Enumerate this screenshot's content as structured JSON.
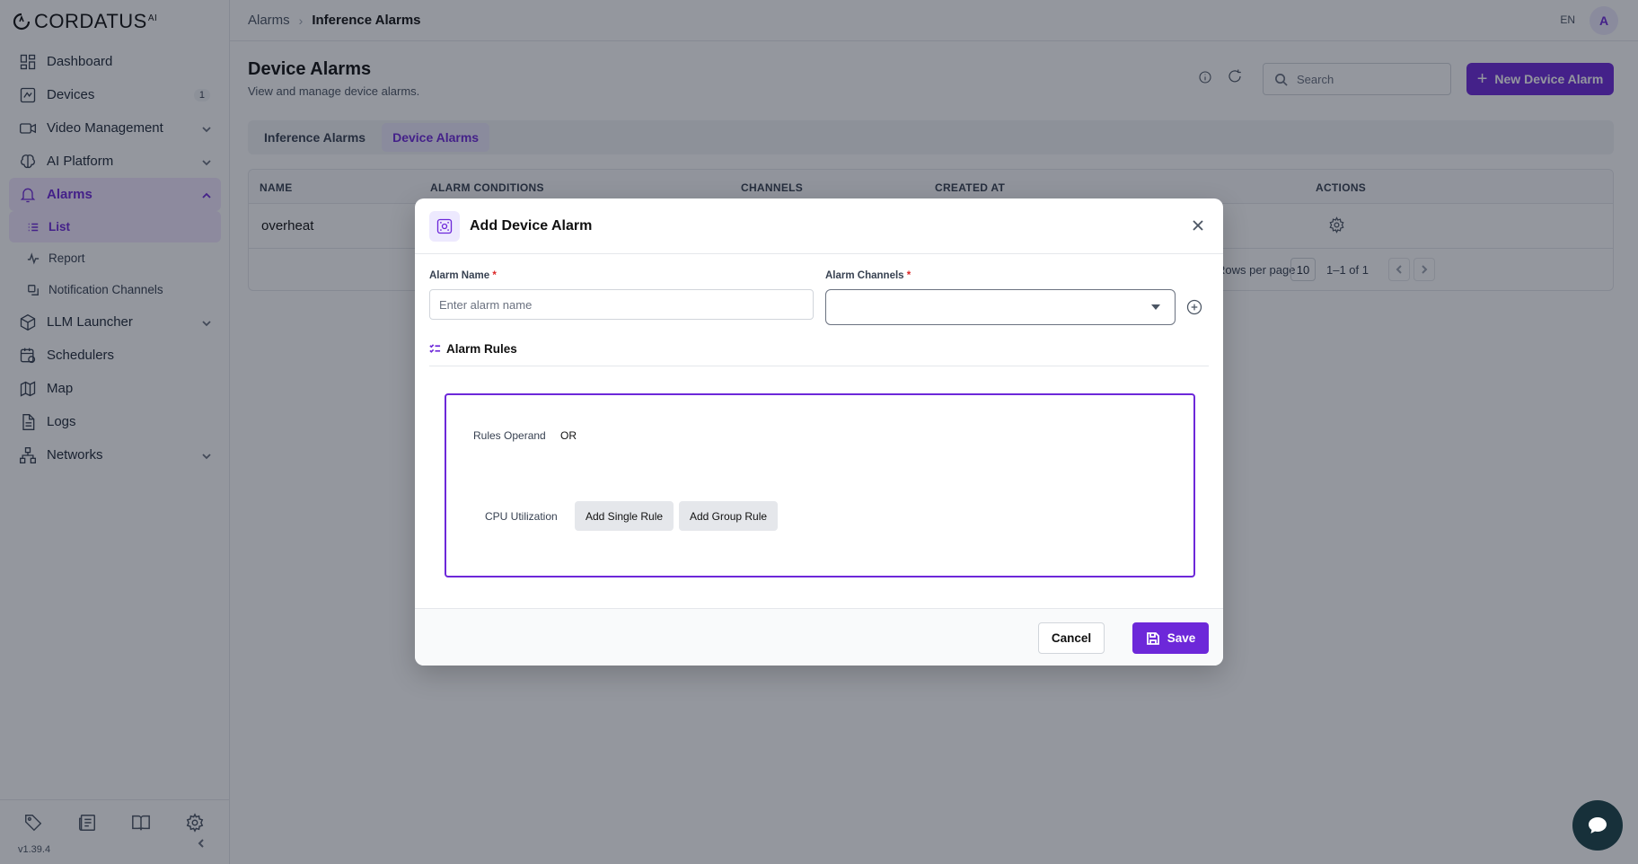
{
  "brand": {
    "name": "CORDATUS",
    "superscript": "AI"
  },
  "sidebar": {
    "items": [
      {
        "label": "Dashboard",
        "icon": "dashboard-icon"
      },
      {
        "label": "Devices",
        "icon": "devices-icon",
        "badge": "1"
      },
      {
        "label": "Video Management",
        "icon": "video-icon"
      },
      {
        "label": "AI Platform",
        "icon": "brain-icon"
      },
      {
        "label": "Alarms",
        "icon": "bell-icon"
      },
      {
        "label": "LLM Launcher",
        "icon": "cube-icon"
      },
      {
        "label": "Schedulers",
        "icon": "calendar-clock-icon"
      },
      {
        "label": "Map",
        "icon": "map-icon"
      },
      {
        "label": "Logs",
        "icon": "file-text-icon"
      },
      {
        "label": "Networks",
        "icon": "network-icon"
      }
    ],
    "alarm_sub": [
      {
        "label": "List",
        "icon": "list-icon"
      },
      {
        "label": "Report",
        "icon": "activity-icon"
      },
      {
        "label": "Notification Channels",
        "icon": "channels-icon"
      }
    ],
    "version": "v1.39.4"
  },
  "topbar": {
    "breadcrumb": [
      "Alarms",
      "Inference Alarms"
    ],
    "lang": "EN",
    "avatar": "A"
  },
  "page": {
    "title": "Device Alarms",
    "subtitle": "View and manage device alarms.",
    "search_placeholder": "Search",
    "new_button": "New Device Alarm",
    "tabs": [
      "Inference Alarms",
      "Device Alarms"
    ],
    "table": {
      "columns": [
        "NAME",
        "ALARM CONDITIONS",
        "CHANNELS",
        "CREATED AT",
        "ACTIONS"
      ],
      "rows": [
        {
          "name": "overheat"
        }
      ],
      "rows_per_page_label": "Rows per page",
      "rows_per_page": "10",
      "range": "1–1 of 1"
    }
  },
  "modal": {
    "title": "Add Device Alarm",
    "alarm_name_label": "Alarm Name",
    "alarm_name_placeholder": "Enter alarm name",
    "alarm_channels_label": "Alarm Channels",
    "required_mark": "*",
    "rules_title": "Alarm Rules",
    "rules_operand_label": "Rules Operand",
    "rules_operand_value": "OR",
    "rule_field": "CPU Utilization",
    "add_single_rule": "Add Single Rule",
    "add_group_rule": "Add Group Rule",
    "cancel": "Cancel",
    "save": "Save"
  },
  "colors": {
    "accent": "#6d28d9",
    "accent_light": "#ede9fe",
    "chat_fab": "#17303a"
  }
}
